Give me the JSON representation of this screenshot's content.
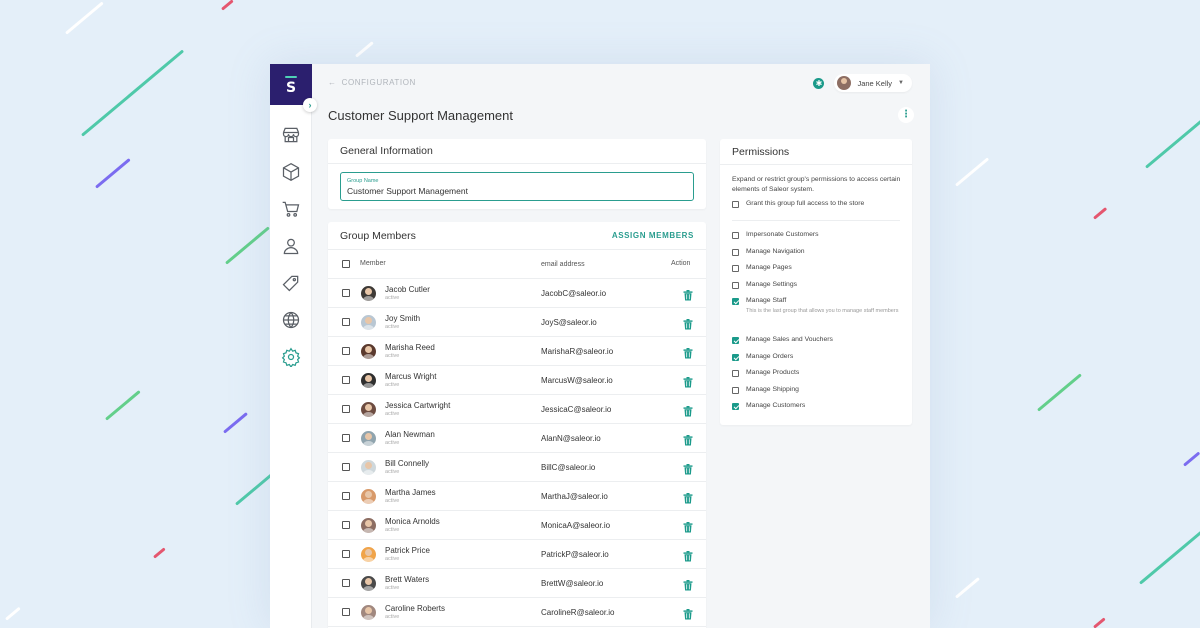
{
  "breadcrumb": {
    "label": "CONFIGURATION"
  },
  "user": {
    "name": "Jane Kelly"
  },
  "page_title": "Customer Support Management",
  "general": {
    "title": "General Information",
    "field_label": "Group Name",
    "field_value": "Customer Support Management"
  },
  "members": {
    "title": "Group Members",
    "assign_label": "ASSIGN MEMBERS",
    "columns": {
      "member": "Member",
      "email": "email address",
      "action": "Action"
    },
    "rows": [
      {
        "name": "Jacob Cutler",
        "status": "active",
        "email": "JacobC@saleor.io",
        "avatar_color": "#3e3a36"
      },
      {
        "name": "Joy Smith",
        "status": "active",
        "email": "JoyS@saleor.io",
        "avatar_color": "#b9c7d3"
      },
      {
        "name": "Marisha Reed",
        "status": "active",
        "email": "MarishaR@saleor.io",
        "avatar_color": "#5b3a2e"
      },
      {
        "name": "Marcus Wright",
        "status": "active",
        "email": "MarcusW@saleor.io",
        "avatar_color": "#2f2f2f"
      },
      {
        "name": "Jessica Cartwright",
        "status": "active",
        "email": "JessicaC@saleor.io",
        "avatar_color": "#6d4c41"
      },
      {
        "name": "Alan Newman",
        "status": "active",
        "email": "AlanN@saleor.io",
        "avatar_color": "#90a4ae"
      },
      {
        "name": "Bill Connelly",
        "status": "active",
        "email": "BillC@saleor.io",
        "avatar_color": "#cfd8dc"
      },
      {
        "name": "Martha James",
        "status": "active",
        "email": "MarthaJ@saleor.io",
        "avatar_color": "#d89a6a"
      },
      {
        "name": "Monica Arnolds",
        "status": "active",
        "email": "MonicaA@saleor.io",
        "avatar_color": "#8d6e63"
      },
      {
        "name": "Patrick Price",
        "status": "active",
        "email": "PatrickP@saleor.io",
        "avatar_color": "#f0a44a"
      },
      {
        "name": "Brett Waters",
        "status": "active",
        "email": "BrettW@saleor.io",
        "avatar_color": "#4a4a4a"
      },
      {
        "name": "Caroline Roberts",
        "status": "active",
        "email": "CarolineR@saleor.io",
        "avatar_color": "#a1887f"
      }
    ]
  },
  "permissions": {
    "title": "Permissions",
    "description": "Expand or restrict group's permissions to access certain elements of Saleor system.",
    "full_access": "Grant this group full access to the store",
    "items": [
      {
        "label": "Impersonate Customers",
        "checked": false
      },
      {
        "label": "Manage Navigation",
        "checked": false
      },
      {
        "label": "Manage Pages",
        "checked": false
      },
      {
        "label": "Manage Settings",
        "checked": false
      },
      {
        "label": "Manage Staff",
        "checked": true,
        "note": "This is the last group that allows you to manage staff members"
      },
      {
        "label": "Manage Sales and Vouchers",
        "checked": true
      },
      {
        "label": "Manage Orders",
        "checked": true
      },
      {
        "label": "Manage Products",
        "checked": false
      },
      {
        "label": "Manage Shipping",
        "checked": false
      },
      {
        "label": "Manage Customers",
        "checked": true
      }
    ]
  },
  "colors": {
    "accent": "#1a9a8a",
    "logo_bg": "#2b1f6e",
    "background": "#e4eff9"
  }
}
